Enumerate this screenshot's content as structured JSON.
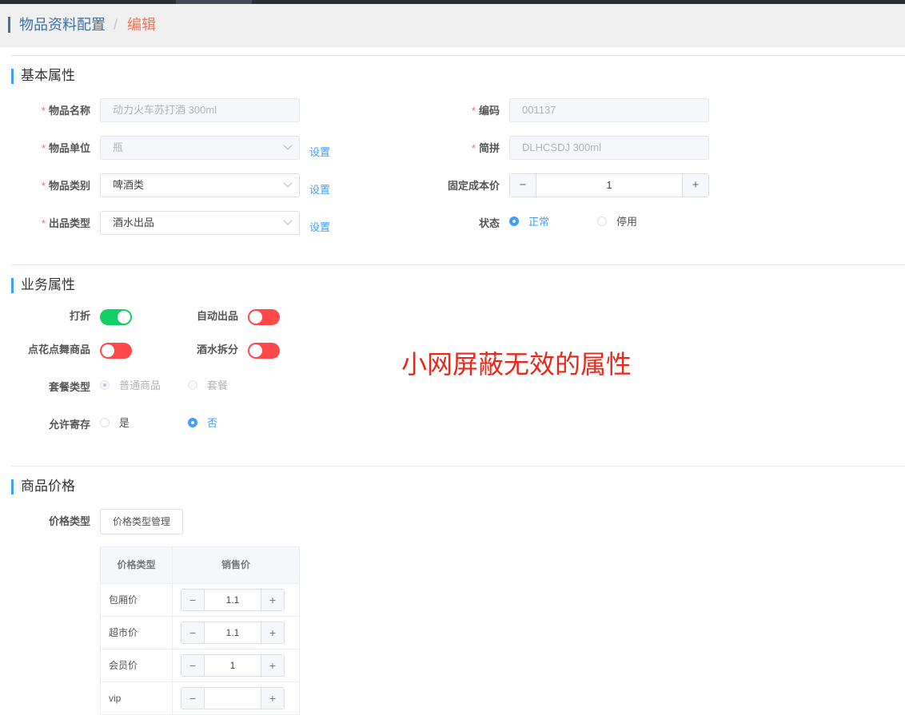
{
  "breadcrumb": {
    "parent": "物品资料配置",
    "separator": "/",
    "current": "编辑"
  },
  "sections": {
    "basic": "基本属性",
    "business": "业务属性",
    "price": "商品价格"
  },
  "basic": {
    "name": {
      "label": "物品名称",
      "required": "*",
      "value": "动力火车苏打酒 300ml"
    },
    "unit": {
      "label": "物品单位",
      "required": "*",
      "value": "瓶",
      "link": "设置"
    },
    "category": {
      "label": "物品类别",
      "required": "*",
      "value": "啤酒类",
      "link": "设置"
    },
    "output_type": {
      "label": "出品类型",
      "required": "*",
      "value": "酒水出品",
      "link": "设置"
    },
    "code": {
      "label": "编码",
      "required": "*",
      "value": "001137"
    },
    "pinyin": {
      "label": "简拼",
      "required": "*",
      "value": "DLHCSDJ 300ml"
    },
    "fixed_cost": {
      "label": "固定成本价",
      "value": "1",
      "minus": "−",
      "plus": "+"
    },
    "status": {
      "label": "状态",
      "options": [
        "正常",
        "停用"
      ],
      "selected": "正常"
    }
  },
  "business": {
    "discount": {
      "label": "打折",
      "on": true
    },
    "auto_output": {
      "label": "自动出品",
      "on": false
    },
    "dance_goods": {
      "label": "点花点舞商品",
      "on": false
    },
    "drink_split": {
      "label": "酒水拆分",
      "on": false
    },
    "package_type": {
      "label": "套餐类型",
      "options": [
        "普通商品",
        "套餐"
      ],
      "selected": "普通商品",
      "disabled": true
    },
    "allow_storage": {
      "label": "允许寄存",
      "options": [
        "是",
        "否"
      ],
      "selected": "否"
    }
  },
  "annotation": "小网屏蔽无效的属性",
  "price": {
    "type_label": "价格类型",
    "manage_button": "价格类型管理",
    "table": {
      "headers": [
        "价格类型",
        "销售价"
      ],
      "rows": [
        {
          "name": "包厢价",
          "value": "1.1"
        },
        {
          "name": "超市价",
          "value": "1.1"
        },
        {
          "name": "会员价",
          "value": "1"
        },
        {
          "name": "vip",
          "value": ""
        }
      ],
      "minus": "−",
      "plus": "+"
    }
  },
  "colors": {
    "accent": "#409eff",
    "switch_on": "#13ce66",
    "switch_off": "#ff4949",
    "annotation": "#e8281b",
    "required": "#f56c6c"
  }
}
